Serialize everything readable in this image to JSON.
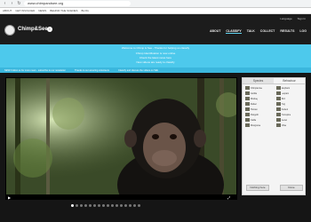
{
  "browser": {
    "url": "www.chimpandsee.org"
  },
  "bookmarks": [
    "ABOUT",
    "GET INVOLVED",
    "NEWS",
    "BEHIND THE SCENES",
    "BLOG"
  ],
  "header": {
    "logo_text": "Chimp&See",
    "top_links": [
      "Language",
      "Sign In"
    ],
    "nav": [
      "ABOUT",
      "CLASSIFY",
      "TALK",
      "COLLECT",
      "RESULTS",
      "LOG"
    ],
    "active_nav": "CLASSIFY"
  },
  "announcement": {
    "lines": [
      "Welcome to Chimp & See - Thanks for helping us classify",
      "Chimp Identification is now online",
      "Check the latest news here",
      "New videos are ready to classify"
    ]
  },
  "ticker": [
    "NEW! Follow us for more news - subscribe to our newsletter",
    "Thanks to our amazing volunteers",
    "Classify and discuss the videos on Talk"
  ],
  "sidebar": {
    "tabs": [
      "Species",
      "Behaviour"
    ],
    "species": [
      "Chimpanzee",
      "Elephant",
      "Gorilla",
      "Leopard",
      "Monkey",
      "Bird",
      "Duiker",
      "Hog",
      "Human",
      "Rodent",
      "Pangolin",
      "Porcupine",
      "Cattle",
      "Genet",
      "Mongoose",
      "Other"
    ],
    "buttons": [
      "Nothing here",
      "Done"
    ]
  }
}
